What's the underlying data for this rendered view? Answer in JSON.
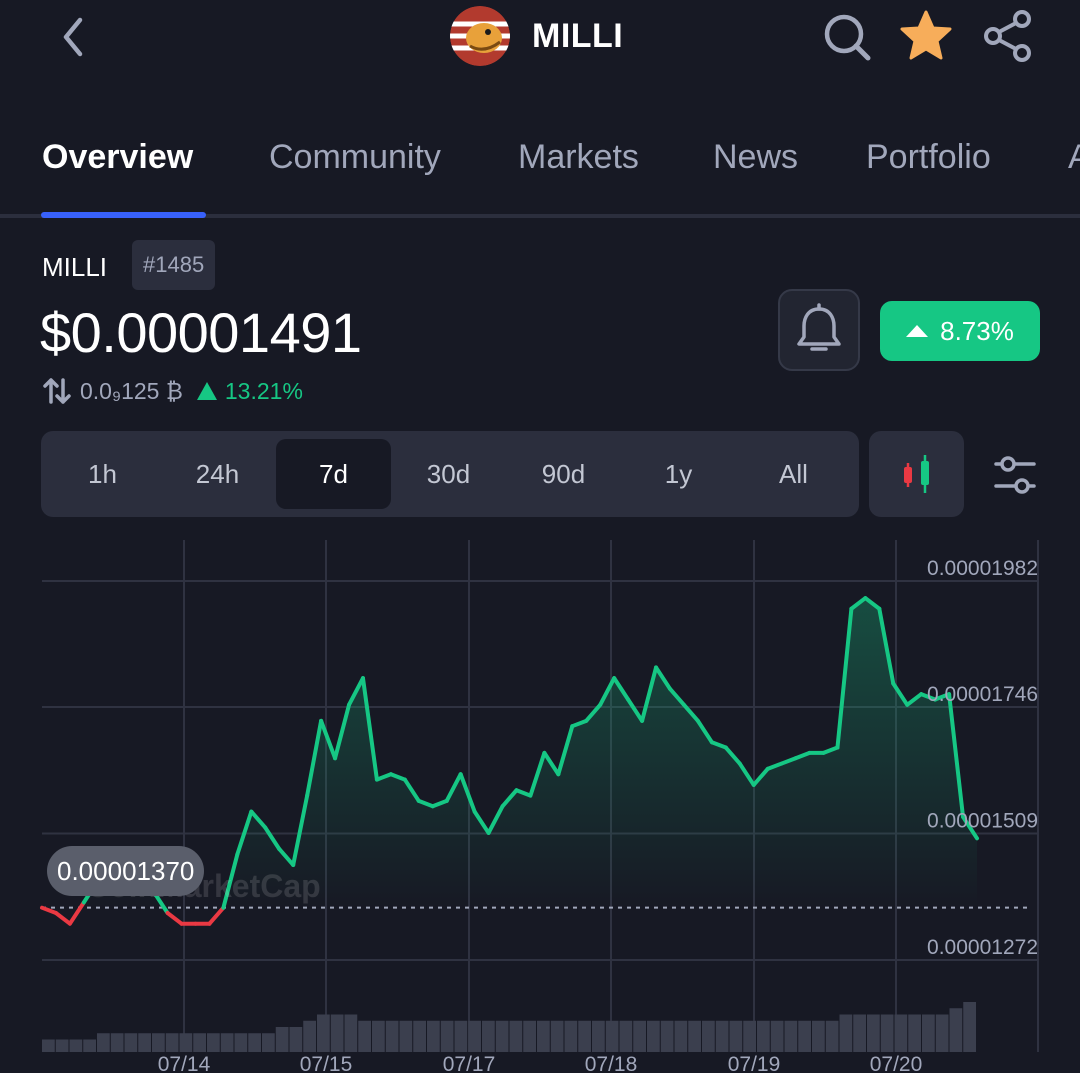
{
  "header": {
    "coin_name": "MILLI",
    "icons": [
      "back-chevron-icon",
      "coin-logo",
      "search-icon",
      "star-icon",
      "share-icon"
    ],
    "colors": {
      "star": "#f7ad5a",
      "accent": "#3861fb"
    }
  },
  "tabs": [
    {
      "label": "Overview",
      "active": true
    },
    {
      "label": "Community",
      "active": false
    },
    {
      "label": "Markets",
      "active": false
    },
    {
      "label": "News",
      "active": false
    },
    {
      "label": "Portfolio",
      "active": false
    },
    {
      "label": "A",
      "active": false
    }
  ],
  "summary": {
    "symbol": "MILLI",
    "rank": "#1485",
    "price": "$0.00001491",
    "change_24h": "8.73%",
    "btc_price": "0.0₉125 ₿",
    "btc_change": "13.21%",
    "colors": {
      "up": "#16c784",
      "down": "#ea3943"
    }
  },
  "time_ranges": [
    {
      "label": "1h",
      "active": false
    },
    {
      "label": "24h",
      "active": false
    },
    {
      "label": "7d",
      "active": true
    },
    {
      "label": "30d",
      "active": false
    },
    {
      "label": "90d",
      "active": false
    },
    {
      "label": "1y",
      "active": false
    },
    {
      "label": "All",
      "active": false
    }
  ],
  "chart_data": {
    "type": "area",
    "reference_value": 1.37e-05,
    "reference_label": "0.00001370",
    "watermark": "CoinMarketCap",
    "y_ticks": [
      "0.00001982",
      "0.00001746",
      "0.00001509",
      "0.00001272"
    ],
    "y_tick_values": [
      1.982e-05,
      1.746e-05,
      1.509e-05,
      1.272e-05
    ],
    "x_ticks": [
      "07/14",
      "07/15",
      "07/17",
      "07/18",
      "07/19",
      "07/20"
    ],
    "grid": true,
    "series": [
      {
        "values": [
          1.37e-05,
          1.36e-05,
          1.34e-05,
          1.38e-05,
          1.42e-05,
          1.47e-05,
          1.45e-05,
          1.46e-05,
          1.4e-05,
          1.36e-05,
          1.34e-05,
          1.34e-05,
          1.34e-05,
          1.37e-05,
          1.47e-05,
          1.55e-05,
          1.52e-05,
          1.48e-05,
          1.45e-05,
          1.58e-05,
          1.72e-05,
          1.65e-05,
          1.75e-05,
          1.8e-05,
          1.61e-05,
          1.62e-05,
          1.61e-05,
          1.57e-05,
          1.56e-05,
          1.57e-05,
          1.62e-05,
          1.55e-05,
          1.51e-05,
          1.56e-05,
          1.59e-05,
          1.58e-05,
          1.66e-05,
          1.62e-05,
          1.71e-05,
          1.72e-05,
          1.75e-05,
          1.8e-05,
          1.76e-05,
          1.72e-05,
          1.82e-05,
          1.78e-05,
          1.75e-05,
          1.72e-05,
          1.68e-05,
          1.67e-05,
          1.64e-05,
          1.6e-05,
          1.63e-05,
          1.64e-05,
          1.65e-05,
          1.66e-05,
          1.66e-05,
          1.67e-05,
          1.93e-05,
          1.95e-05,
          1.93e-05,
          1.79e-05,
          1.75e-05,
          1.77e-05,
          1.76e-05,
          1.77e-05,
          1.54e-05,
          1.5e-05
        ]
      }
    ],
    "volume": [
      2,
      2,
      2,
      2,
      3,
      3,
      3,
      3,
      3,
      3,
      3,
      3,
      3,
      3,
      3,
      3,
      3,
      4,
      4,
      5,
      6,
      6,
      6,
      5,
      5,
      5,
      5,
      5,
      5,
      5,
      5,
      5,
      5,
      5,
      5,
      5,
      5,
      5,
      5,
      5,
      5,
      5,
      5,
      5,
      5,
      5,
      5,
      5,
      5,
      5,
      5,
      5,
      5,
      5,
      5,
      5,
      5,
      5,
      6,
      6,
      6,
      6,
      6,
      6,
      6,
      6,
      7,
      8
    ]
  }
}
